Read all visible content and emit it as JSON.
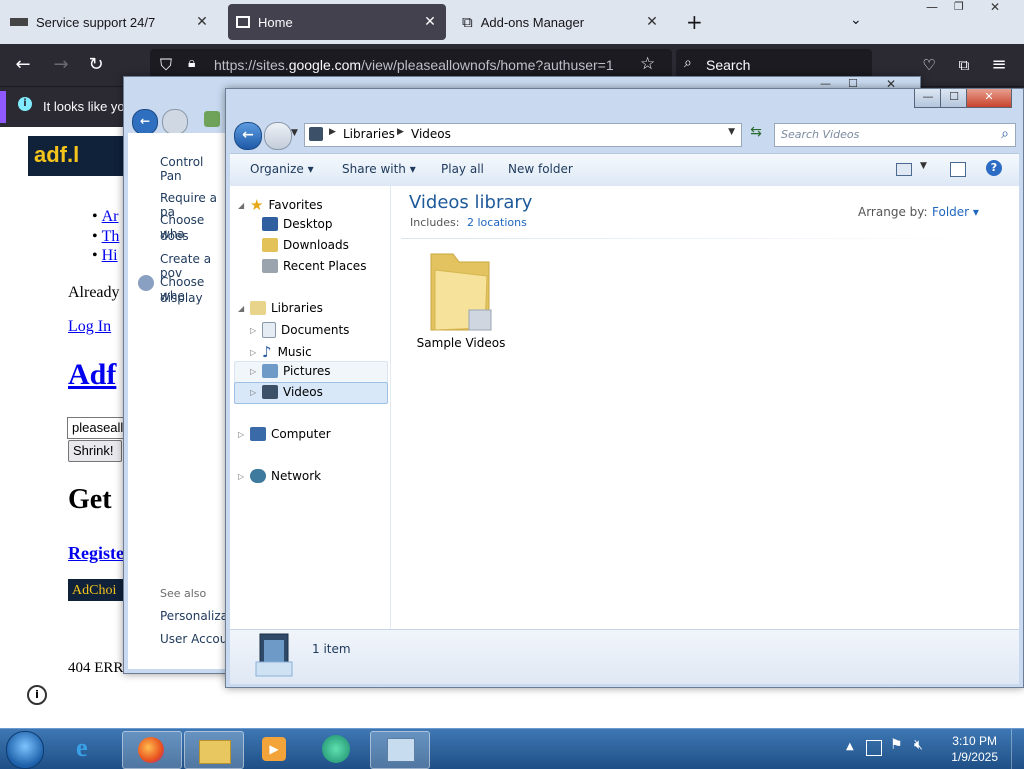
{
  "firefox": {
    "tabs": [
      {
        "label": "Service support 24/7"
      },
      {
        "label": "Home"
      },
      {
        "label": "Add-ons Manager"
      }
    ],
    "url_prefix": "https://sites.",
    "url_domain": "google.com",
    "url_suffix": "/view/pleaseallownofs/home?authuser=1",
    "search_label": "Search",
    "notification": "It looks like you"
  },
  "webpage": {
    "logo": "adf.l",
    "list_items": [
      "Ar",
      "Th",
      "Hi"
    ],
    "already": "Already",
    "login": "Log In",
    "heading": "Adf",
    "input_value": "pleaseall",
    "shrink": "Shrink!",
    "get": "Get",
    "register": "Registe",
    "adchoices": "AdChoi",
    "error": "404 ERR"
  },
  "control_panel": {
    "items": [
      "Control Pan",
      "Require a pa",
      "Choose wha",
      "does",
      "Create a pov",
      "Choose whe",
      "display"
    ],
    "see_also": "See also",
    "see_also_items": [
      "Personalizati",
      "User Accou"
    ]
  },
  "explorer": {
    "breadcrumb": [
      "Libraries",
      "Videos"
    ],
    "search_placeholder": "Search Videos",
    "commands": {
      "organize": "Organize",
      "share": "Share with",
      "play": "Play all",
      "new_folder": "New folder"
    },
    "nav": {
      "favorites": "Favorites",
      "desktop": "Desktop",
      "downloads": "Downloads",
      "recent": "Recent Places",
      "libraries": "Libraries",
      "documents": "Documents",
      "music": "Music",
      "pictures": "Pictures",
      "videos": "Videos",
      "computer": "Computer",
      "network": "Network"
    },
    "library_title": "Videos library",
    "includes_label": "Includes:",
    "includes_link": "2 locations",
    "arrange_label": "Arrange by:",
    "arrange_value": "Folder",
    "folder_name": "Sample Videos",
    "status": "1 item"
  },
  "taskbar": {
    "time": "3:10 PM",
    "date": "1/9/2025"
  }
}
